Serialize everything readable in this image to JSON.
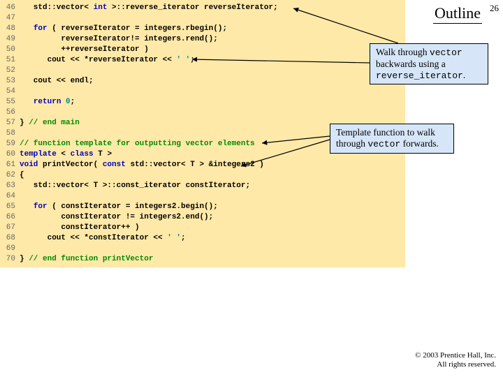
{
  "slide": {
    "outline_label": "Outline",
    "number": "26"
  },
  "callouts": {
    "c1_pre": "Walk through ",
    "c1_v": "vector",
    "c1_mid": " backwards using a ",
    "c1_r": "reverse_iterator",
    "c1_end": ".",
    "c2_pre": "Template function to walk through ",
    "c2_v": "vector",
    "c2_end": " forwards."
  },
  "copyright": {
    "line1": "© 2003 Prentice Hall, Inc.",
    "line2": "All rights reserved."
  },
  "code": {
    "l46_a": "   std::vector< ",
    "l46_b": "int",
    "l46_c": " >::reverse_iterator reverseIterator;",
    "l48_a": "   ",
    "l48_b": "for",
    "l48_c": " ( reverseIterator = integers.rbegin();",
    "l49": "         reverseIterator!= integers.rend();",
    "l50": "         ++reverseIterator )",
    "l51_a": "      cout << *reverseIterator << ",
    "l51_b": "' '",
    "l51_c": ";  ",
    "l53": "   cout << endl;",
    "l55_a": "   ",
    "l55_b": "return",
    "l55_c": " ",
    "l55_d": "0",
    "l55_e": ";",
    "l57_a": "} ",
    "l57_b": "// end main",
    "l59": "// function template for outputting vector elements",
    "l60_a": "template",
    "l60_b": " < ",
    "l60_c": "class",
    "l60_d": " T >",
    "l61_a": "void",
    "l61_b": " printVector( ",
    "l61_c": "const",
    "l61_d": " std::vector< T > &integers2 )",
    "l62": "{",
    "l63": "   std::vector< T >::const_iterator constIterator;",
    "l65_a": "   ",
    "l65_b": "for",
    "l65_c": " ( constIterator = integers2.begin();",
    "l66": "         constIterator != integers2.end();",
    "l67": "         constIterator++ )",
    "l68_a": "      cout << *constIterator << ",
    "l68_b": "' '",
    "l68_c": ";",
    "l70_a": "} ",
    "l70_b": "// end function printVector"
  },
  "gutter": {
    "g46": "46",
    "g47": "47",
    "g48": "48",
    "g49": "49",
    "g50": "50",
    "g51": "51",
    "g52": "52",
    "g53": "53",
    "g54": "54",
    "g55": "55",
    "g56": "56",
    "g57": "57",
    "g58": "58",
    "g59": "59",
    "g60": "60",
    "g61": "61",
    "g62": "62",
    "g63": "63",
    "g64": "64",
    "g65": "65",
    "g66": "66",
    "g67": "67",
    "g68": "68",
    "g69": "69",
    "g70": "70"
  }
}
